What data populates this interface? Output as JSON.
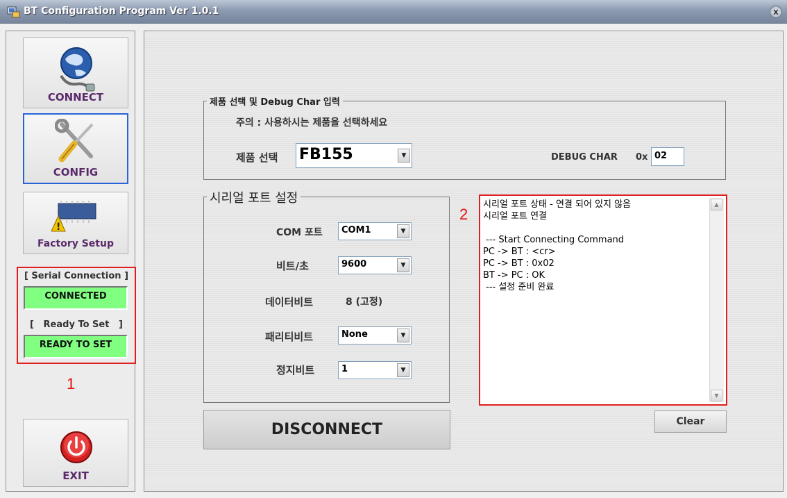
{
  "window": {
    "title": "BT Configuration Program Ver 1.0.1",
    "close_glyph": "x"
  },
  "sidebar": {
    "connect_label": "CONNECT",
    "config_label": "CONFIG",
    "factory_label": "Factory Setup",
    "exit_label": "EXIT",
    "status": {
      "serial_title": "[ Serial Connection ]",
      "serial_value": "CONNECTED",
      "ready_title": "[   Ready To Set   ]",
      "ready_value": "READY TO SET",
      "status_color": "#80ff80"
    },
    "annotation_number": "1"
  },
  "product_group": {
    "legend": "제품 선택 및 Debug Char 입력",
    "notice": "주의 : 사용하시는 제품을 선택하세요",
    "product_label": "제품 선택",
    "product_value": "FB155",
    "debug_label": "DEBUG CHAR",
    "debug_prefix": "0x",
    "debug_value": "02"
  },
  "serial_group": {
    "legend": "시리얼 포트 설정",
    "com_label": "COM 포트",
    "com_value": "COM1",
    "baud_label": "비트/초",
    "baud_value": "9600",
    "databits_label": "데이터비트",
    "databits_value": "8 (고정)",
    "parity_label": "패리티비트",
    "parity_value": "None",
    "stopbits_label": "정지비트",
    "stopbits_value": "1"
  },
  "log": {
    "annotation_number": "2",
    "lines": "시리얼 포트 상태 - 연결 되어 있지 않음\n시리얼 포트 연결\n\n --- Start Connecting Command\nPC -> BT : <cr>\nPC -> BT : 0x02\nBT -> PC : OK\n --- 설정 준비 완료"
  },
  "buttons": {
    "disconnect": "DISCONNECT",
    "clear": "Clear"
  },
  "colors": {
    "highlight_border": "#e02020",
    "selected_border": "#2a62d8"
  }
}
